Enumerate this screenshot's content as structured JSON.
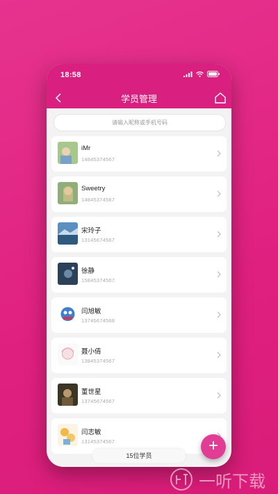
{
  "status_bar": {
    "time": "18:58"
  },
  "header": {
    "title": "学员管理"
  },
  "search": {
    "placeholder": "请输入昵称或手机号码"
  },
  "students": [
    {
      "name": "iMr",
      "phone": "14845374567"
    },
    {
      "name": "Sweetry",
      "phone": "14845374567"
    },
    {
      "name": "宋玲子",
      "phone": "13145674567"
    },
    {
      "name": "徐静",
      "phone": "15845374567"
    },
    {
      "name": "闫旭敏",
      "phone": "13745674568"
    },
    {
      "name": "聂小倩",
      "phone": "13845374567"
    },
    {
      "name": "董世星",
      "phone": "13745674567"
    },
    {
      "name": "闫志敏",
      "phone": "13145374567"
    }
  ],
  "footer": {
    "count_label": "15位学员"
  },
  "fab": {
    "label": "+"
  },
  "watermark": {
    "text": "一听下载"
  },
  "colors": {
    "accent": "#d91f7f",
    "background": "#e0207f"
  }
}
